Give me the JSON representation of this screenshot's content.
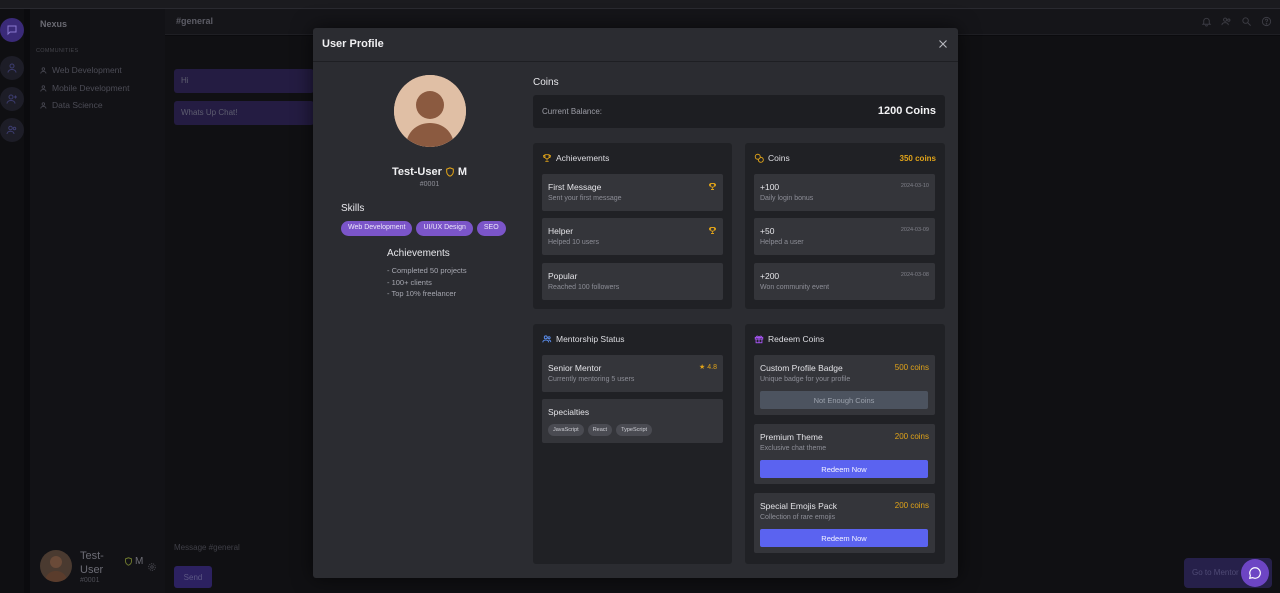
{
  "app": {
    "server_name": "Nexus",
    "communities_label": "COMMUNITIES",
    "communities": [
      "Web Development",
      "Mobile Development",
      "Data Science"
    ],
    "channel": "#general",
    "messages": [
      "Hi",
      "Whats Up Chat!"
    ],
    "message_placeholder": "Message #general",
    "send_label": "Send",
    "mentor_label": "Go to Mentor",
    "user": {
      "name": "Test-User",
      "tag": "#0001",
      "badge": "M"
    }
  },
  "modal": {
    "title": "User Profile",
    "profile": {
      "name": "Test-User",
      "badge": "M",
      "tag": "#0001",
      "skills_title": "Skills",
      "skills": [
        "Web Development",
        "UI/UX Design",
        "SEO"
      ],
      "achievements_title": "Achievements",
      "achievements": [
        "- Completed 50 projects",
        "- 100+ clients",
        "- Top 10% freelancer"
      ]
    },
    "coins_section": {
      "title": "Coins",
      "balance_label": "Current Balance:",
      "balance_value": "1200 Coins"
    },
    "achievements_card": {
      "title": "Achievements",
      "items": [
        {
          "title": "First Message",
          "subtitle": "Sent your first message",
          "earned": true
        },
        {
          "title": "Helper",
          "subtitle": "Helped 10 users",
          "earned": true
        },
        {
          "title": "Popular",
          "subtitle": "Reached 100 followers",
          "earned": false
        }
      ]
    },
    "coins_card": {
      "title": "Coins",
      "total": "350 coins",
      "items": [
        {
          "amount": "+100",
          "description": "Daily login bonus",
          "date": "2024-03-10"
        },
        {
          "amount": "+50",
          "description": "Helped a user",
          "date": "2024-03-09"
        },
        {
          "amount": "+200",
          "description": "Won community event",
          "date": "2024-03-08"
        }
      ]
    },
    "mentorship_card": {
      "title": "Mentorship Status",
      "status": "Senior Mentor",
      "rating": "★ 4.8",
      "detail": "Currently mentoring 5 users",
      "specialties_title": "Specialties",
      "specialties": [
        "JavaScript",
        "React",
        "TypeScript"
      ]
    },
    "redeem_card": {
      "title": "Redeem Coins",
      "items": [
        {
          "title": "Custom Profile Badge",
          "subtitle": "Unique badge for your profile",
          "cost": "500 coins",
          "button": "Not Enough Coins",
          "available": false
        },
        {
          "title": "Premium Theme",
          "subtitle": "Exclusive chat theme",
          "cost": "200 coins",
          "button": "Redeem Now",
          "available": true
        },
        {
          "title": "Special Emojis Pack",
          "subtitle": "Collection of rare emojis",
          "cost": "200 coins",
          "button": "Redeem Now",
          "available": true
        }
      ]
    }
  },
  "colors": {
    "accent": "#7b55c9",
    "gold": "#e0a319",
    "redeem": "#5b63f0",
    "modal_bg": "#2b2c31",
    "card_bg": "#202125"
  },
  "icons": [
    "chat-bubble-icon",
    "user-icon",
    "user-add-icon",
    "users-icon",
    "bell-icon",
    "search-icon",
    "help-icon",
    "close-icon",
    "shield-icon",
    "trophy-icon",
    "coins-icon",
    "gift-icon",
    "gear-icon"
  ]
}
